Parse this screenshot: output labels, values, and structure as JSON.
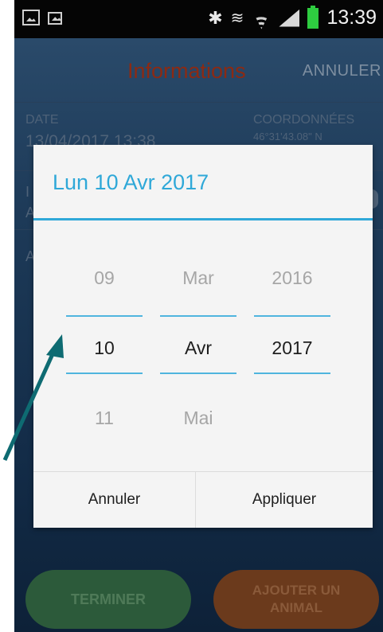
{
  "status_bar": {
    "time": "13:39",
    "icons": [
      "image-icon",
      "outlook-icon",
      "bluetooth-icon",
      "vibrate-icon",
      "wifi-icon",
      "signal-icon",
      "battery-icon"
    ]
  },
  "app": {
    "title": "Informations",
    "cancel_label": "ANNULER",
    "date_label": "DATE",
    "date_value": "13/04/2017 13:38",
    "coord_label": "COORDONNÉES",
    "coord_value": "46°31'43.08\" N",
    "row2_fragment_1": "I",
    "row2_fragment_2": "A",
    "row3_fragment": "A",
    "finish_label": "TERMINER",
    "add_animal_label": "AJOUTER UN ANIMAL"
  },
  "dialog": {
    "title": "Lun 10 Avr 2017",
    "day": {
      "prev": "09",
      "current": "10",
      "next": "11"
    },
    "month": {
      "prev": "Mar",
      "current": "Avr",
      "next": "Mai"
    },
    "year": {
      "prev": "2016",
      "current": "2017",
      "next": ""
    },
    "cancel_label": "Annuler",
    "apply_label": "Appliquer"
  },
  "colors": {
    "accent": "#2fa8d8",
    "arrow": "#0e6b72"
  }
}
